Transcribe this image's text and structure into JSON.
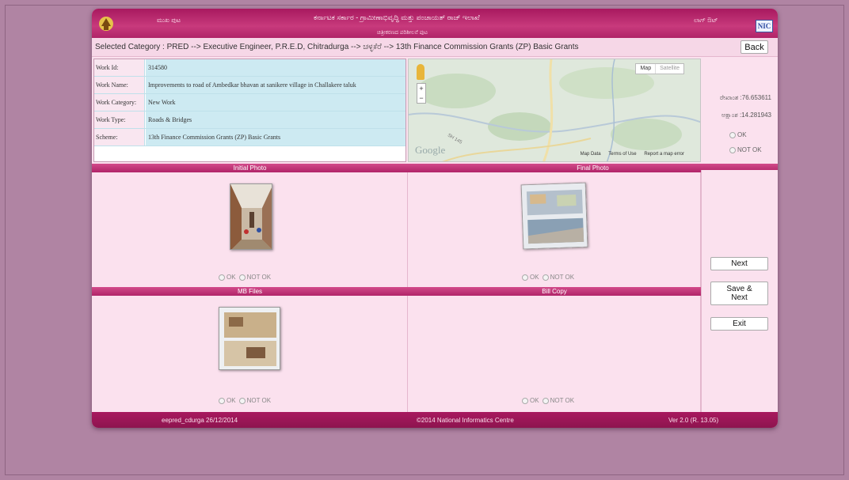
{
  "header": {
    "kannada_left": "ಮುಖ ಪುಟ",
    "kannada_title": "ಕರ್ನಾಟಕ ಸರ್ಕಾರ - ಗ್ರಾಮೀಣಾಭಿವೃದ್ಧಿ ಮತ್ತು ಪಂಚಾಯತ್ ರಾಜ್ ಇಲಾಖೆ",
    "kannada_subtitle": "ಚಿತ್ರೀಕರಣದ ಪರಿಶೀಲನೆ ಪುಟ",
    "kannada_right": "ಲಾಗ್ ಔಟ್",
    "nic_logo": "NIC"
  },
  "category": {
    "text": "Selected Category : PRED --> Executive Engineer, P.R.E.D, Chitradurga --> ಚಳ್ಳಕೆರೆ --> 13th Finance Commission Grants (ZP) Basic Grants",
    "back_label": "Back"
  },
  "work": {
    "rows": [
      {
        "label": "Work Id:",
        "value": "314580"
      },
      {
        "label": "Work Name:",
        "value": "Improvements to road of Ambedkar bhavan at sanikere village in Challakere taluk"
      },
      {
        "label": "Work Category:",
        "value": "New Work"
      },
      {
        "label": "Work Type:",
        "value": "Roads & Bridges"
      },
      {
        "label": "Scheme:",
        "value": "13th Finance Commission Grants (ZP) Basic Grants"
      }
    ]
  },
  "map": {
    "type_map": "Map",
    "type_satellite": "Satellite",
    "zoom_in": "+",
    "zoom_out": "−",
    "road_label": "SH 145",
    "google_label": "Google",
    "footer_data": "Map Data",
    "footer_terms": "Terms of Use",
    "footer_report": "Report a map error"
  },
  "coords": {
    "longitude": "ರೇಖಾಂಶ :76.653611",
    "latitude": "ಅಕ್ಷಾಂಶ :14.281943",
    "ok": "OK",
    "not_ok": "NOT OK"
  },
  "sections": {
    "initial_photo": "Initial Photo",
    "final_photo": "Final Photo",
    "mb_files": "MB Files",
    "bill_copy": "Bill Copy",
    "ok": "OK",
    "not_ok": "NOT OK"
  },
  "buttons": {
    "next": "Next",
    "save_next_1": "Save &",
    "save_next_2": "Next",
    "exit": "Exit"
  },
  "footer": {
    "user": "eepred_cdurga 26/12/2014",
    "copyright": "©2014 National Informatics Centre",
    "version": "Ver 2.0 (R. 13.05)"
  }
}
